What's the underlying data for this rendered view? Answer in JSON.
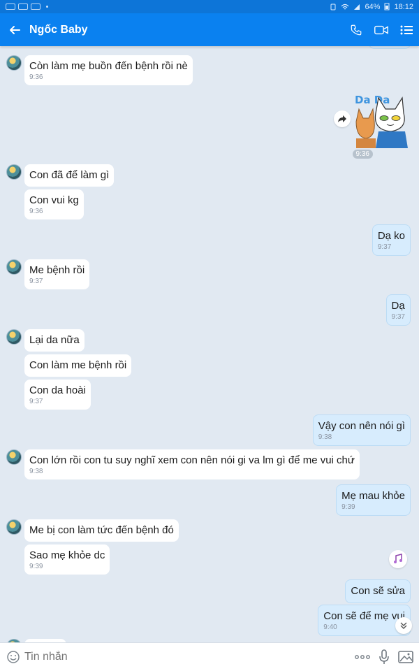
{
  "status_bar": {
    "battery": "64%",
    "time": "18:12"
  },
  "header": {
    "contact_name": "Ngốc Baby"
  },
  "messages": [
    {
      "text": "Còn làm mẹ buồn đến bệnh rồi nè",
      "time": "9:36"
    },
    {
      "sticker_time": "9:36",
      "sticker_text": "Da Da"
    },
    {
      "text": "Con đã để làm gì"
    },
    {
      "text": "Con vui kg",
      "time": "9:36"
    },
    {
      "text": "Dạ ko",
      "time": "9:37"
    },
    {
      "text": "Me bệnh rồi",
      "time": "9:37"
    },
    {
      "text": "Dạ",
      "time": "9:37"
    },
    {
      "text": "Lại da nữa"
    },
    {
      "text": "Con làm me bệnh rồi"
    },
    {
      "text": "Con da hoài",
      "time": "9:37"
    },
    {
      "text": "Vậy con nên nói gì",
      "time": "9:38"
    },
    {
      "text": "Con lớn rồi con tu suy nghĩ xem con nên nói gi va lm gì để me vui chứ",
      "time": "9:38"
    },
    {
      "text": "Mẹ mau khỏe",
      "time": "9:39"
    },
    {
      "text": "Me bị con làm tức đến bệnh đó"
    },
    {
      "text": "Sao mẹ khỏe dc",
      "time": "9:39"
    },
    {
      "text": "Con sẽ sửa"
    },
    {
      "text": "Con sẽ để mẹ vui",
      "time": "9:40"
    }
  ],
  "input": {
    "placeholder": "Tin nhắn"
  },
  "icons": {
    "back": "back-arrow-icon",
    "call": "phone-icon",
    "video": "video-call-icon",
    "menu": "list-menu-icon",
    "emoji": "emoji-icon",
    "more": "more-dots-icon",
    "mic": "microphone-icon",
    "image": "image-icon",
    "forward": "forward-icon",
    "music": "music-note-icon",
    "scroll": "scroll-down-icon"
  },
  "colors": {
    "header": "#0a81f0",
    "background": "#e1e9f2",
    "outgoing_bubble": "#d7ecfd",
    "incoming_bubble": "#ffffff"
  }
}
